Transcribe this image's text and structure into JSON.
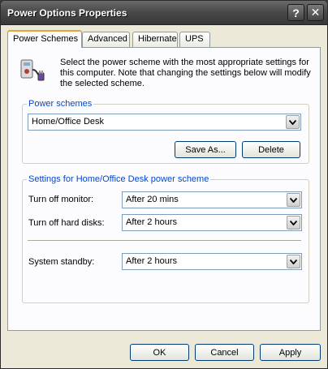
{
  "window": {
    "title": "Power Options Properties",
    "help_glyph": "?",
    "close_glyph": "✕"
  },
  "tabs": [
    {
      "label": "Power Schemes",
      "active": true
    },
    {
      "label": "Advanced",
      "active": false
    },
    {
      "label": "Hibernate",
      "active": false
    },
    {
      "label": "UPS",
      "active": false
    }
  ],
  "intro": {
    "icon": "power-scheme-icon",
    "text": "Select the power scheme with the most appropriate settings for this computer. Note that changing the settings below will modify the selected scheme."
  },
  "power_schemes": {
    "group_title": "Power schemes",
    "selected": "Home/Office Desk",
    "save_as_label": "Save As...",
    "delete_label": "Delete"
  },
  "settings": {
    "group_title": "Settings for Home/Office Desk power scheme",
    "rows": [
      {
        "label": "Turn off monitor:",
        "value": "After 20 mins"
      },
      {
        "label": "Turn off hard disks:",
        "value": "After 2 hours"
      },
      {
        "label": "System standby:",
        "value": "After 2 hours"
      }
    ]
  },
  "footer": {
    "ok_label": "OK",
    "cancel_label": "Cancel",
    "apply_label": "Apply"
  },
  "colors": {
    "group_title": "#0046d5",
    "tab_highlight": "#e6a53a"
  }
}
